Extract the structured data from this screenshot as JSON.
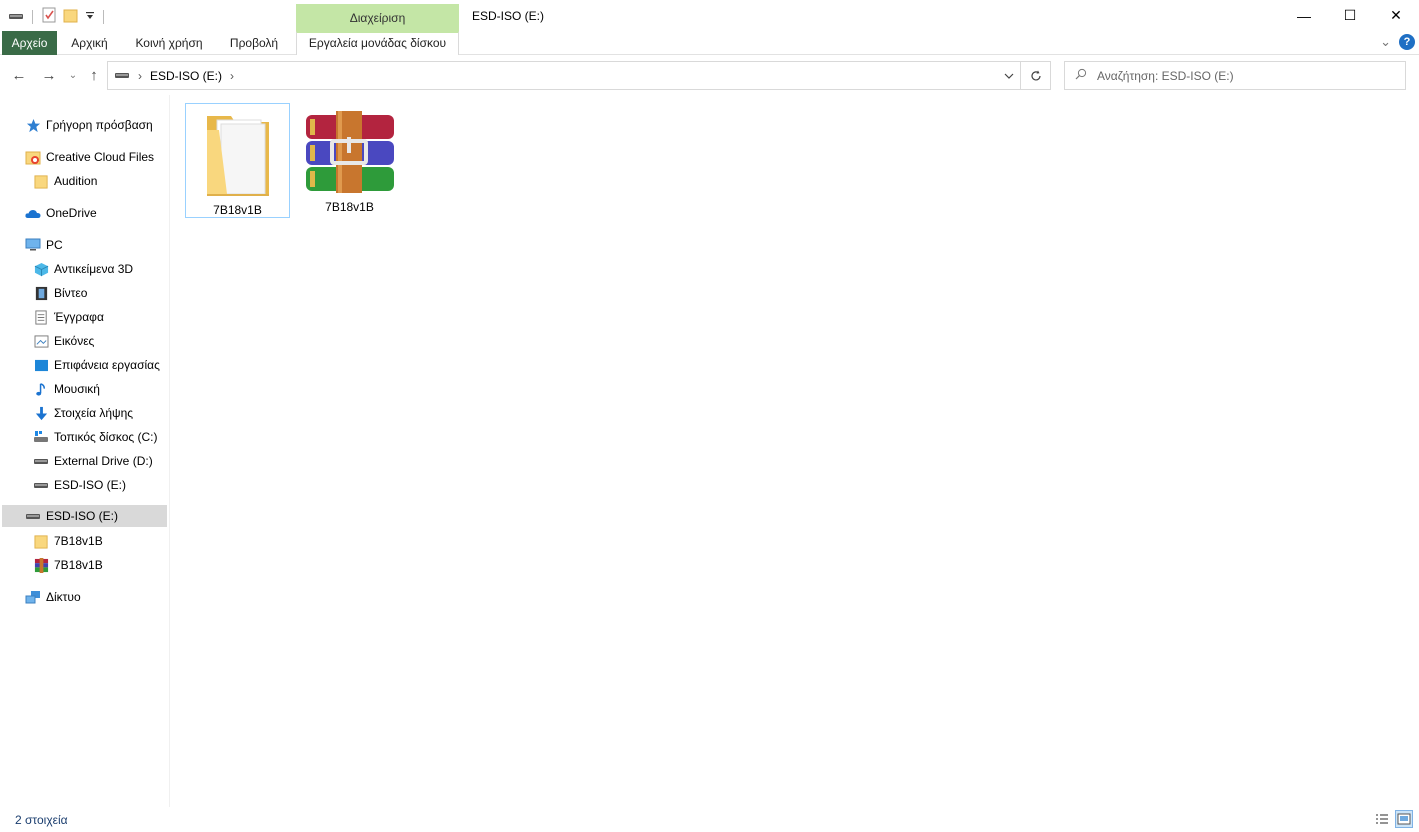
{
  "window": {
    "title": "ESD-ISO (E:)",
    "context_header": "Διαχείριση",
    "minimize": "—",
    "maximize": "☐",
    "close": "✕"
  },
  "ribbon": {
    "tabs": [
      {
        "label": "Αρχείο"
      },
      {
        "label": "Αρχική"
      },
      {
        "label": "Κοινή χρήση"
      },
      {
        "label": "Προβολή"
      },
      {
        "label": "Εργαλεία μονάδας δίσκου"
      }
    ],
    "expand": "⌄",
    "help": "?"
  },
  "navigation": {
    "back": "←",
    "forward": "→",
    "recent": "⌄",
    "up": "↑",
    "path": "ESD-ISO (E:)",
    "sep1": "›",
    "sep2": "›",
    "search_placeholder": "Αναζήτηση: ESD-ISO (E:)"
  },
  "sidebar": {
    "items": [
      {
        "label": "Γρήγορη πρόσβαση",
        "icon": "star-icon"
      },
      {
        "label": "Creative Cloud Files",
        "icon": "creative-cloud-icon"
      },
      {
        "label": "Audition",
        "icon": "folder-icon"
      },
      {
        "label": "OneDrive",
        "icon": "onedrive-icon"
      },
      {
        "label": "PC",
        "icon": "pc-icon"
      },
      {
        "label": "Αντικείμενα 3D",
        "icon": "3d-objects-icon"
      },
      {
        "label": "Βίντεο",
        "icon": "video-icon"
      },
      {
        "label": "Έγγραφα",
        "icon": "documents-icon"
      },
      {
        "label": "Εικόνες",
        "icon": "pictures-icon"
      },
      {
        "label": "Επιφάνεια εργασίας",
        "icon": "desktop-icon"
      },
      {
        "label": "Μουσική",
        "icon": "music-icon"
      },
      {
        "label": "Στοιχεία λήψης",
        "icon": "downloads-icon"
      },
      {
        "label": "Τοπικός δίσκος (C:)",
        "icon": "local-disk-icon"
      },
      {
        "label": "External Drive (D:)",
        "icon": "drive-icon"
      },
      {
        "label": "ESD-ISO (E:)",
        "icon": "drive-icon"
      },
      {
        "label": "ESD-ISO (E:)",
        "icon": "drive-icon"
      },
      {
        "label": "7B18v1B",
        "icon": "folder-icon"
      },
      {
        "label": "7B18v1B",
        "icon": "winrar-icon"
      },
      {
        "label": "Δίκτυο",
        "icon": "network-icon"
      }
    ]
  },
  "files": [
    {
      "name": "7B18v1B",
      "icon": "folder-icon"
    },
    {
      "name": "7B18v1B",
      "icon": "winrar-archive-icon"
    }
  ],
  "status": {
    "count": "2 στοιχεία"
  }
}
